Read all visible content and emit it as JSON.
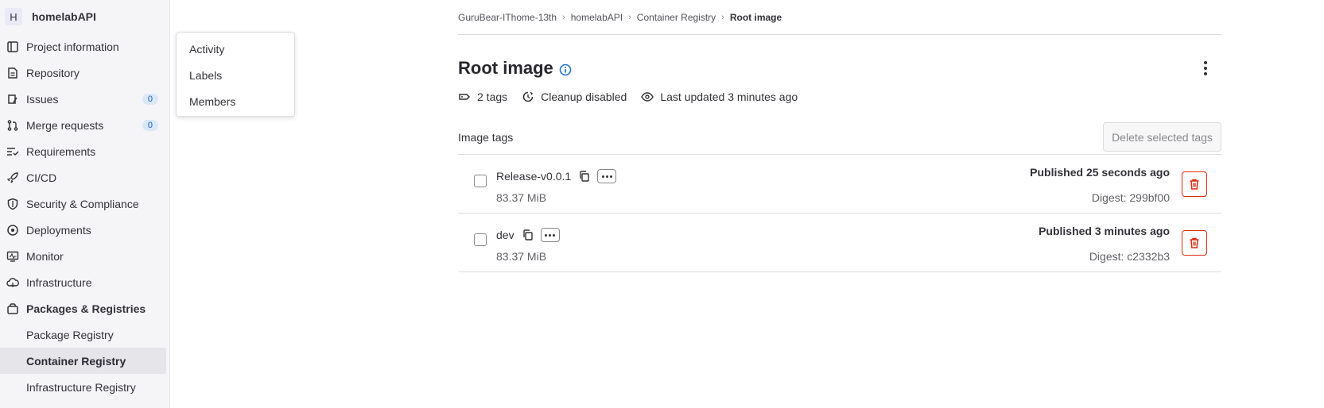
{
  "sidebar": {
    "project_initial": "H",
    "project_name": "homelabAPI",
    "items": [
      {
        "label": "Project information",
        "icon": "project-icon"
      },
      {
        "label": "Repository",
        "icon": "repository-icon"
      },
      {
        "label": "Issues",
        "icon": "issues-icon",
        "badge": "0"
      },
      {
        "label": "Merge requests",
        "icon": "merge-request-icon",
        "badge": "0"
      },
      {
        "label": "Requirements",
        "icon": "requirements-icon"
      },
      {
        "label": "CI/CD",
        "icon": "rocket-icon"
      },
      {
        "label": "Security & Compliance",
        "icon": "shield-icon"
      },
      {
        "label": "Deployments",
        "icon": "deployments-icon"
      },
      {
        "label": "Monitor",
        "icon": "monitor-icon"
      },
      {
        "label": "Infrastructure",
        "icon": "cloud-icon"
      },
      {
        "label": "Packages & Registries",
        "icon": "package-icon"
      }
    ],
    "sub_items": [
      {
        "label": "Package Registry"
      },
      {
        "label": "Container Registry"
      },
      {
        "label": "Infrastructure Registry"
      }
    ]
  },
  "flyout": {
    "items": [
      "Activity",
      "Labels",
      "Members"
    ]
  },
  "breadcrumb": [
    "GuruBear-IThome-13th",
    "homelabAPI",
    "Container Registry",
    "Root image"
  ],
  "page": {
    "title": "Root image",
    "meta": {
      "tags": "2 tags",
      "cleanup": "Cleanup disabled",
      "updated": "Last updated 3 minutes ago"
    },
    "section_title": "Image tags",
    "delete_selected_label": "Delete selected tags"
  },
  "tags": [
    {
      "name": "Release-v0.0.1",
      "size": "83.37 MiB",
      "published": "Published 25 seconds ago",
      "digest": "Digest: 299bf00"
    },
    {
      "name": "dev",
      "size": "83.37 MiB",
      "published": "Published 3 minutes ago",
      "digest": "Digest: c2332b3"
    }
  ],
  "colors": {
    "danger": "#dd2b0e",
    "info": "#1f75cb",
    "sidebar_bg": "#f5f5f7"
  }
}
